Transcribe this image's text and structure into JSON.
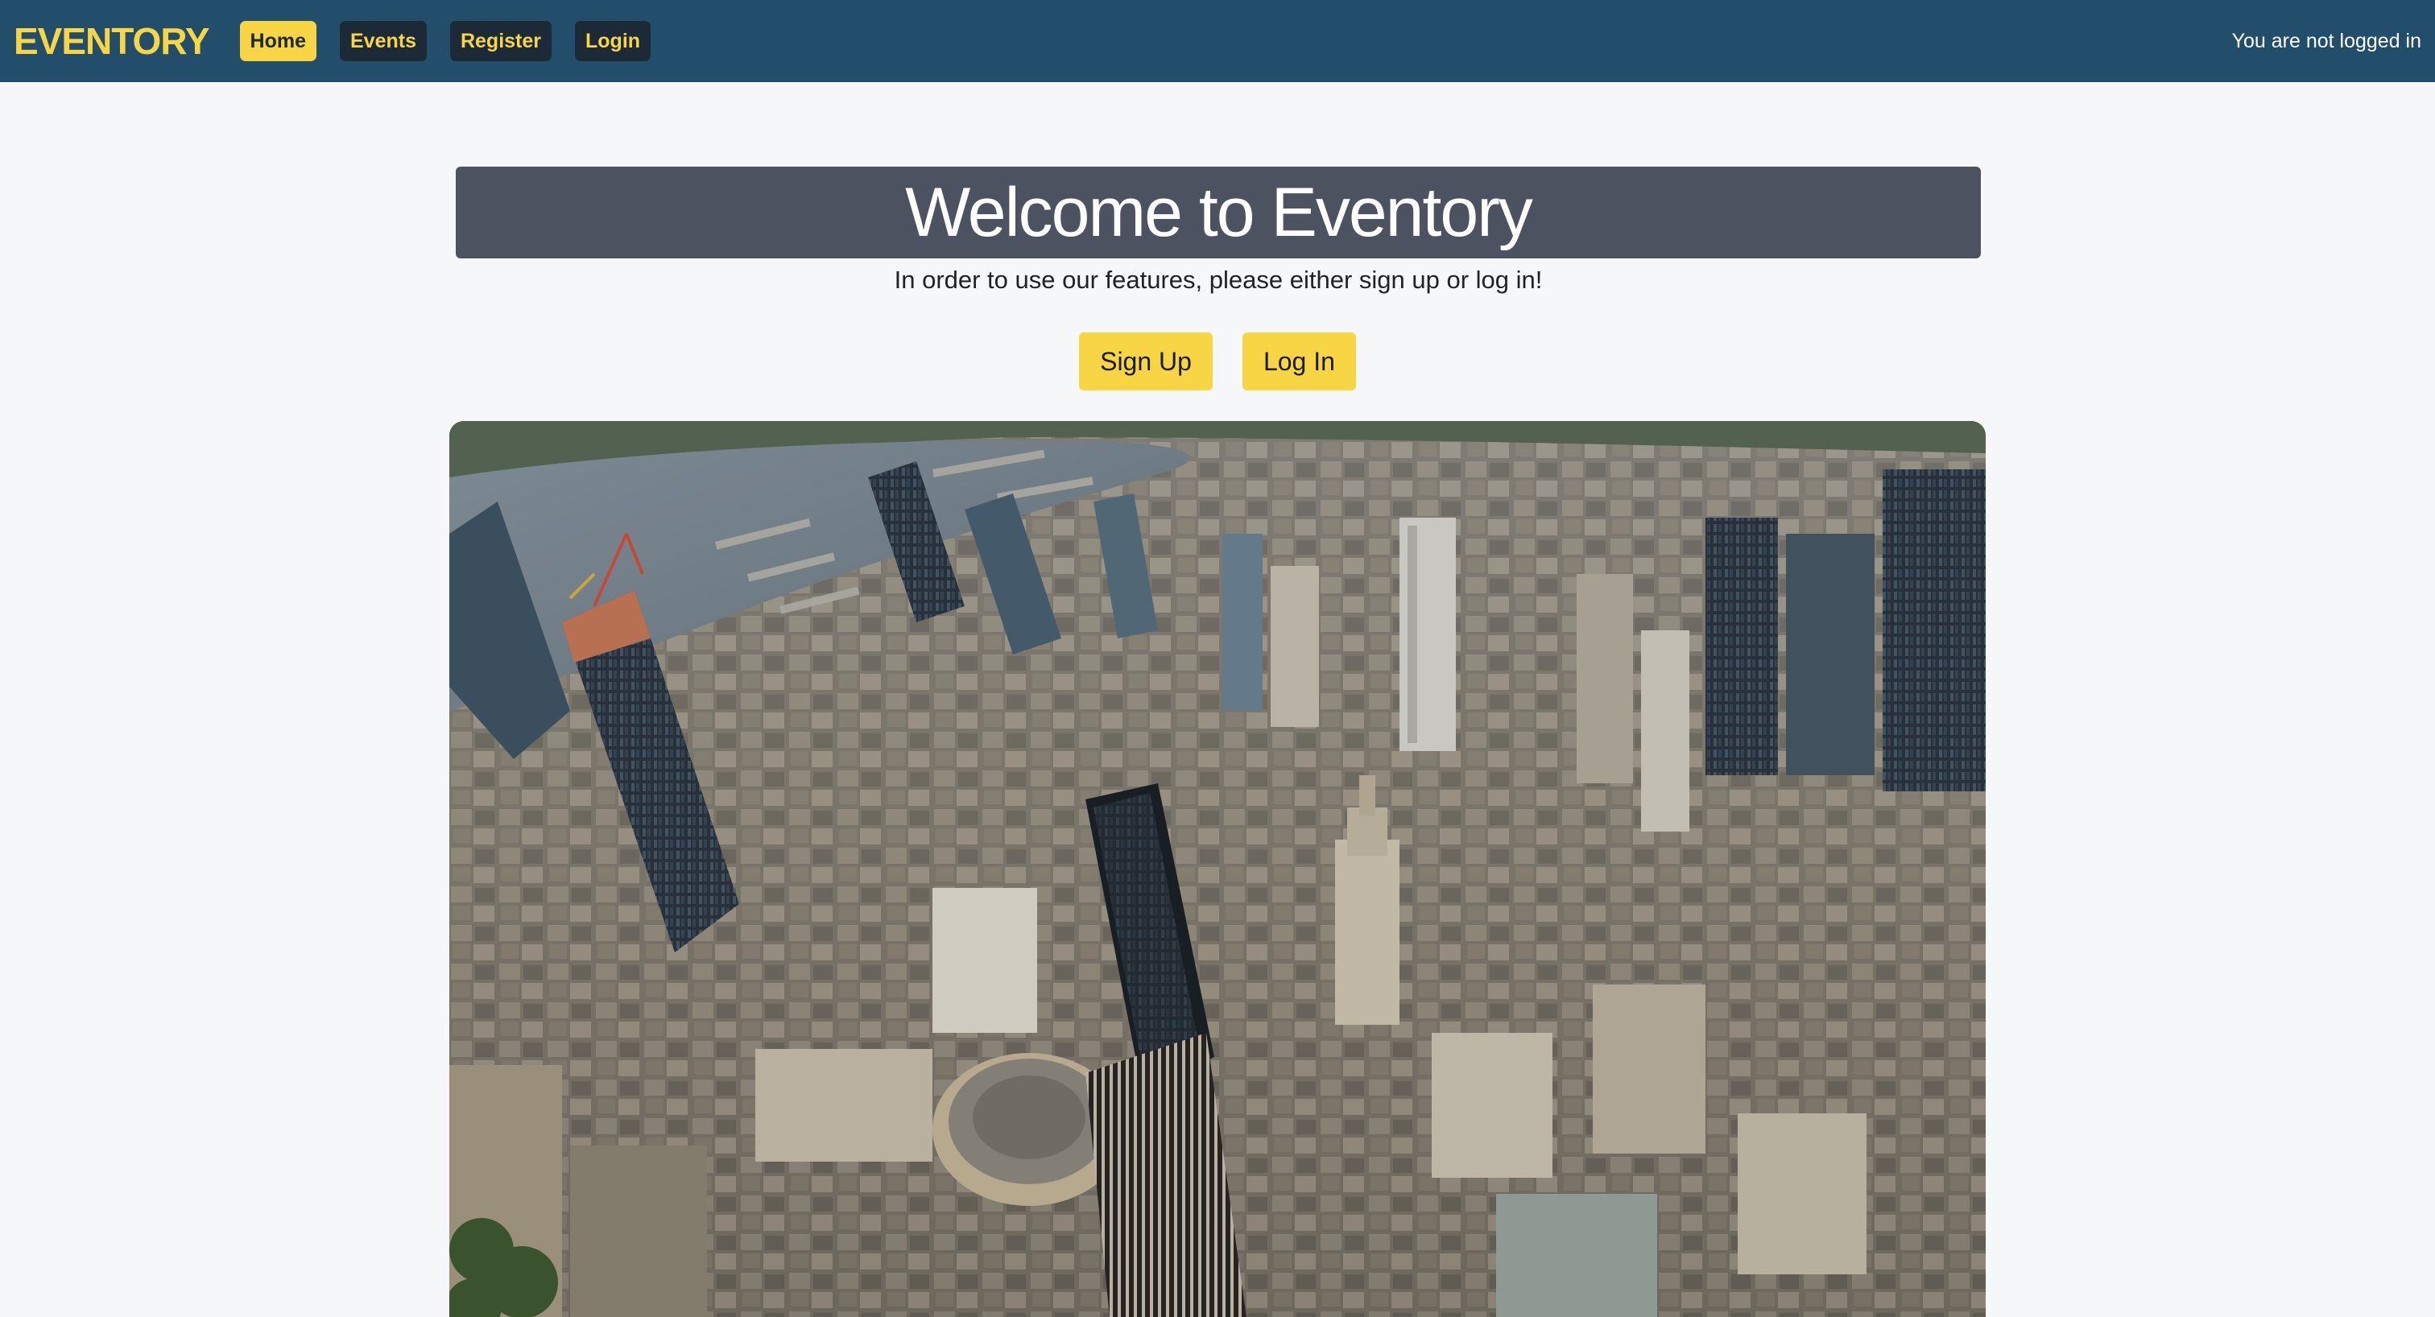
{
  "navbar": {
    "brand": "EVENTORY",
    "items": [
      {
        "label": "Home",
        "active": true
      },
      {
        "label": "Events",
        "active": false
      },
      {
        "label": "Register",
        "active": false
      },
      {
        "label": "Login",
        "active": false
      }
    ],
    "status": "You are not logged in"
  },
  "hero": {
    "heading": "Welcome to Eventory",
    "subtitle": "In order to use our features, please either sign up or log in!",
    "signup_label": "Sign Up",
    "login_label": "Log In"
  },
  "colors": {
    "navbar_bg": "#224d6b",
    "accent": "#f7d544",
    "nav_button_bg": "#1b2a36",
    "banner_bg": "#4c525f",
    "page_bg": "#f5f7f9"
  },
  "image": {
    "subject": "aerial city skyline photo"
  }
}
